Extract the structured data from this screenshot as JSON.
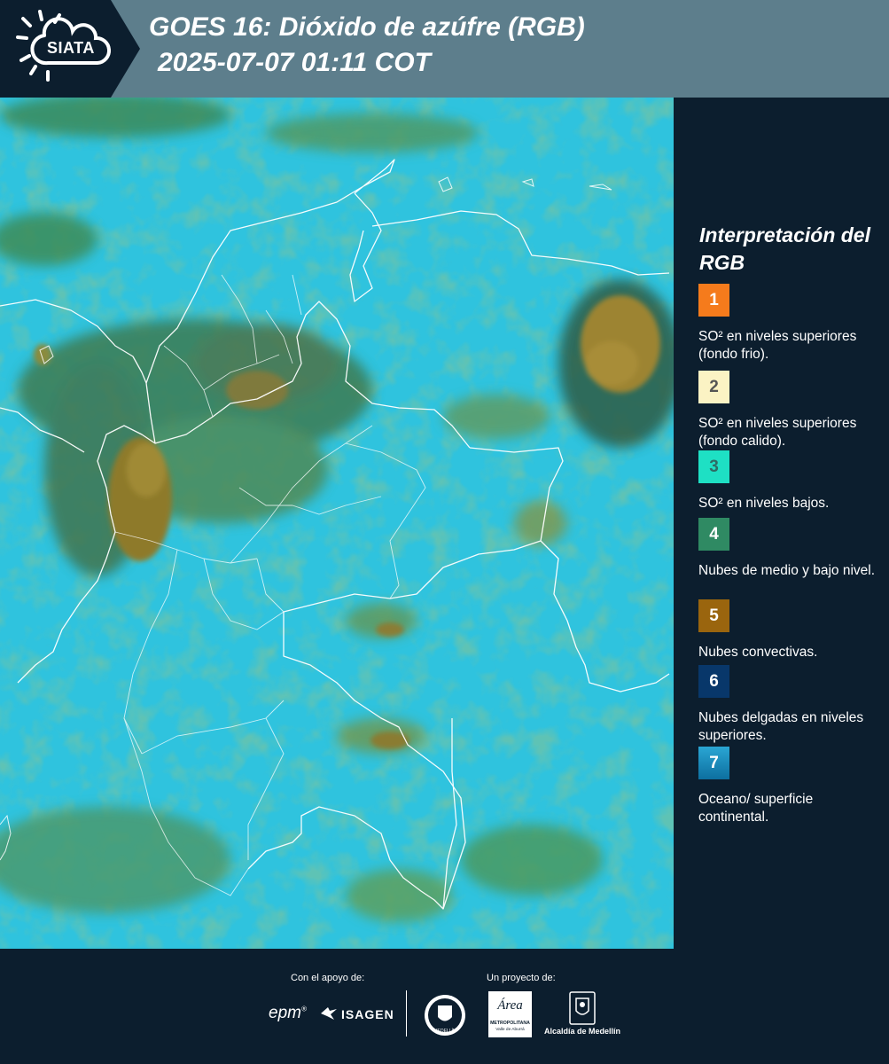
{
  "header": {
    "logo_text": "SIATA",
    "title_line1": "GOES 16: Dióxido de azúfre (RGB)",
    "title_line2": "2025-07-07 01:11 COT"
  },
  "legend": {
    "title": "Interpretación del RGB",
    "items": [
      {
        "number": "1",
        "color": "#f57b1c",
        "label": "SO² en niveles superiores (fondo frio)."
      },
      {
        "number": "2",
        "color": "#fbf3c4",
        "label": "SO² en niveles superiores (fondo calido)."
      },
      {
        "number": "3",
        "color": "#1ee0c4",
        "label": "SO² en niveles bajos."
      },
      {
        "number": "4",
        "color": "#2f8a63",
        "label": "Nubes de medio y bajo nivel."
      },
      {
        "number": "5",
        "color": "#9a650e",
        "label": "Nubes convectivas."
      },
      {
        "number": "6",
        "color": "#08376a",
        "label": "Nubes delgadas en niveles superiores."
      },
      {
        "number": "7",
        "color": "#1790c0",
        "label": "Oceano/ superficie continental."
      }
    ]
  },
  "footer": {
    "support_label": "Con el apoyo de:",
    "project_label": "Un proyecto de:",
    "epm": "epm",
    "isagen": "ISAGEN",
    "metro_brand": "Área",
    "metro_line1": "METROPOLITANA",
    "metro_line2": "Valle de Aburrá",
    "alcaldia": "Alcaldía de Medellín",
    "seal_text": "MEDELLÍN"
  }
}
